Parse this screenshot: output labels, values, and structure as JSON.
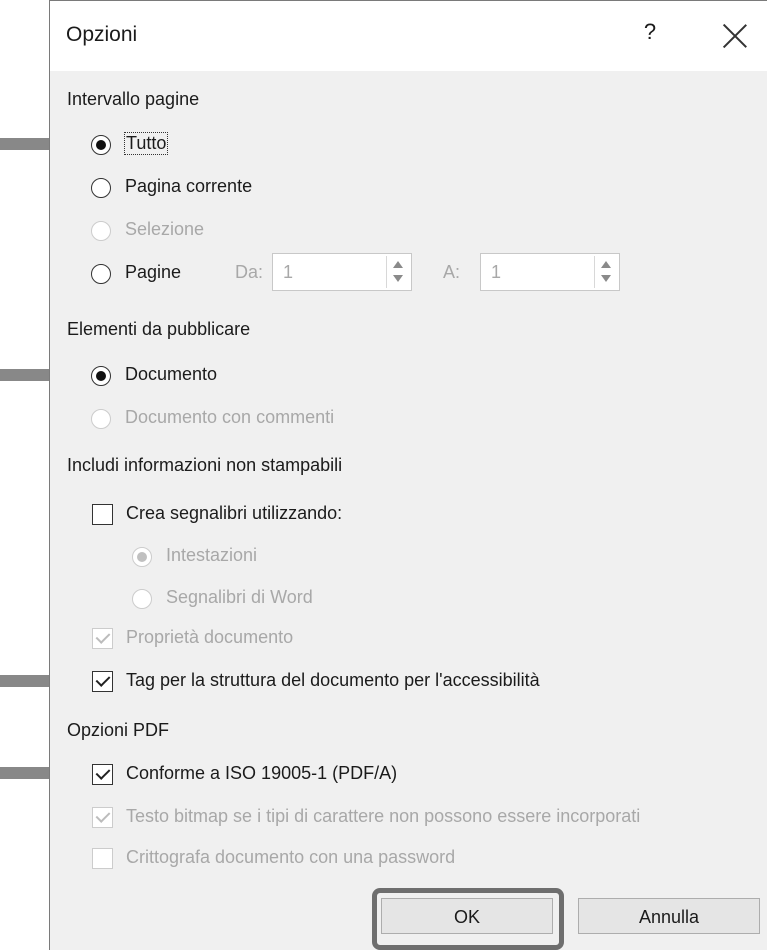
{
  "dialog": {
    "title": "Opzioni",
    "help": "?"
  },
  "groups": {
    "page_range": "Intervallo pagine",
    "publish": "Elementi da pubblicare",
    "nonprint": "Includi informazioni non stampabili",
    "pdf": "Opzioni PDF"
  },
  "page_range": {
    "all": "Tutto",
    "current": "Pagina corrente",
    "selection": "Selezione",
    "pages": "Pagine",
    "from_label": "Da:",
    "from_value": "1",
    "to_label": "A:",
    "to_value": "1"
  },
  "publish": {
    "document": "Documento",
    "with_comments": "Documento con commenti"
  },
  "nonprint": {
    "bookmarks": "Crea segnalibri utilizzando:",
    "headings": "Intestazioni",
    "word_bookmarks": "Segnalibri di Word",
    "properties": "Proprietà documento",
    "tags": "Tag per la struttura del documento per l'accessibilità"
  },
  "pdf": {
    "iso": "Conforme a ISO 19005-1 (PDF/A)",
    "bitmap": "Testo bitmap se i tipi di carattere non possono essere incorporati",
    "encrypt": "Crittografa documento con una password"
  },
  "buttons": {
    "ok": "OK",
    "cancel": "Annulla"
  },
  "state": {
    "page_range_selected": "all",
    "publish_selected": "document",
    "bookmarks_checked": false,
    "properties_checked": true,
    "tags_checked": true,
    "iso_checked": true,
    "bitmap_checked": true,
    "encrypt_checked": false
  },
  "colors": {
    "arrow": "#888888",
    "disabled_text": "#a8a8a8",
    "dialog_bg": "#f0f0f0"
  }
}
